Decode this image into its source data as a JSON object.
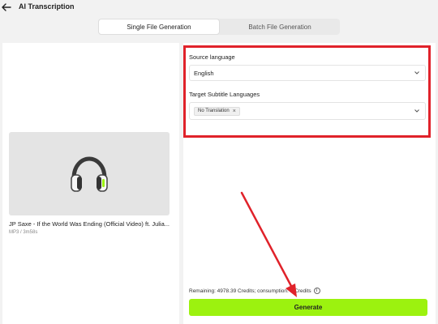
{
  "header": {
    "title": "AI Transcription"
  },
  "tabs": [
    {
      "label": "Single File Generation",
      "active": true
    },
    {
      "label": "Batch File Generation",
      "active": false
    }
  ],
  "media": {
    "file_name": "JP Saxe - If the World Was Ending (Official Video) ft. Julia...",
    "file_meta": "MP3 / 3m58s",
    "icon": "headphones-icon"
  },
  "form": {
    "source_language_label": "Source language",
    "source_language_value": "English",
    "target_label": "Target Subtitle Languages",
    "target_chip": "No Translation",
    "chip_remove": "×"
  },
  "footer": {
    "remaining_text": "Remaining: 4978.39 Credits; consumption: 1 Credits",
    "generate_label": "Generate"
  },
  "colors": {
    "accent": "#9cf20f",
    "annotation": "#e0222a"
  }
}
